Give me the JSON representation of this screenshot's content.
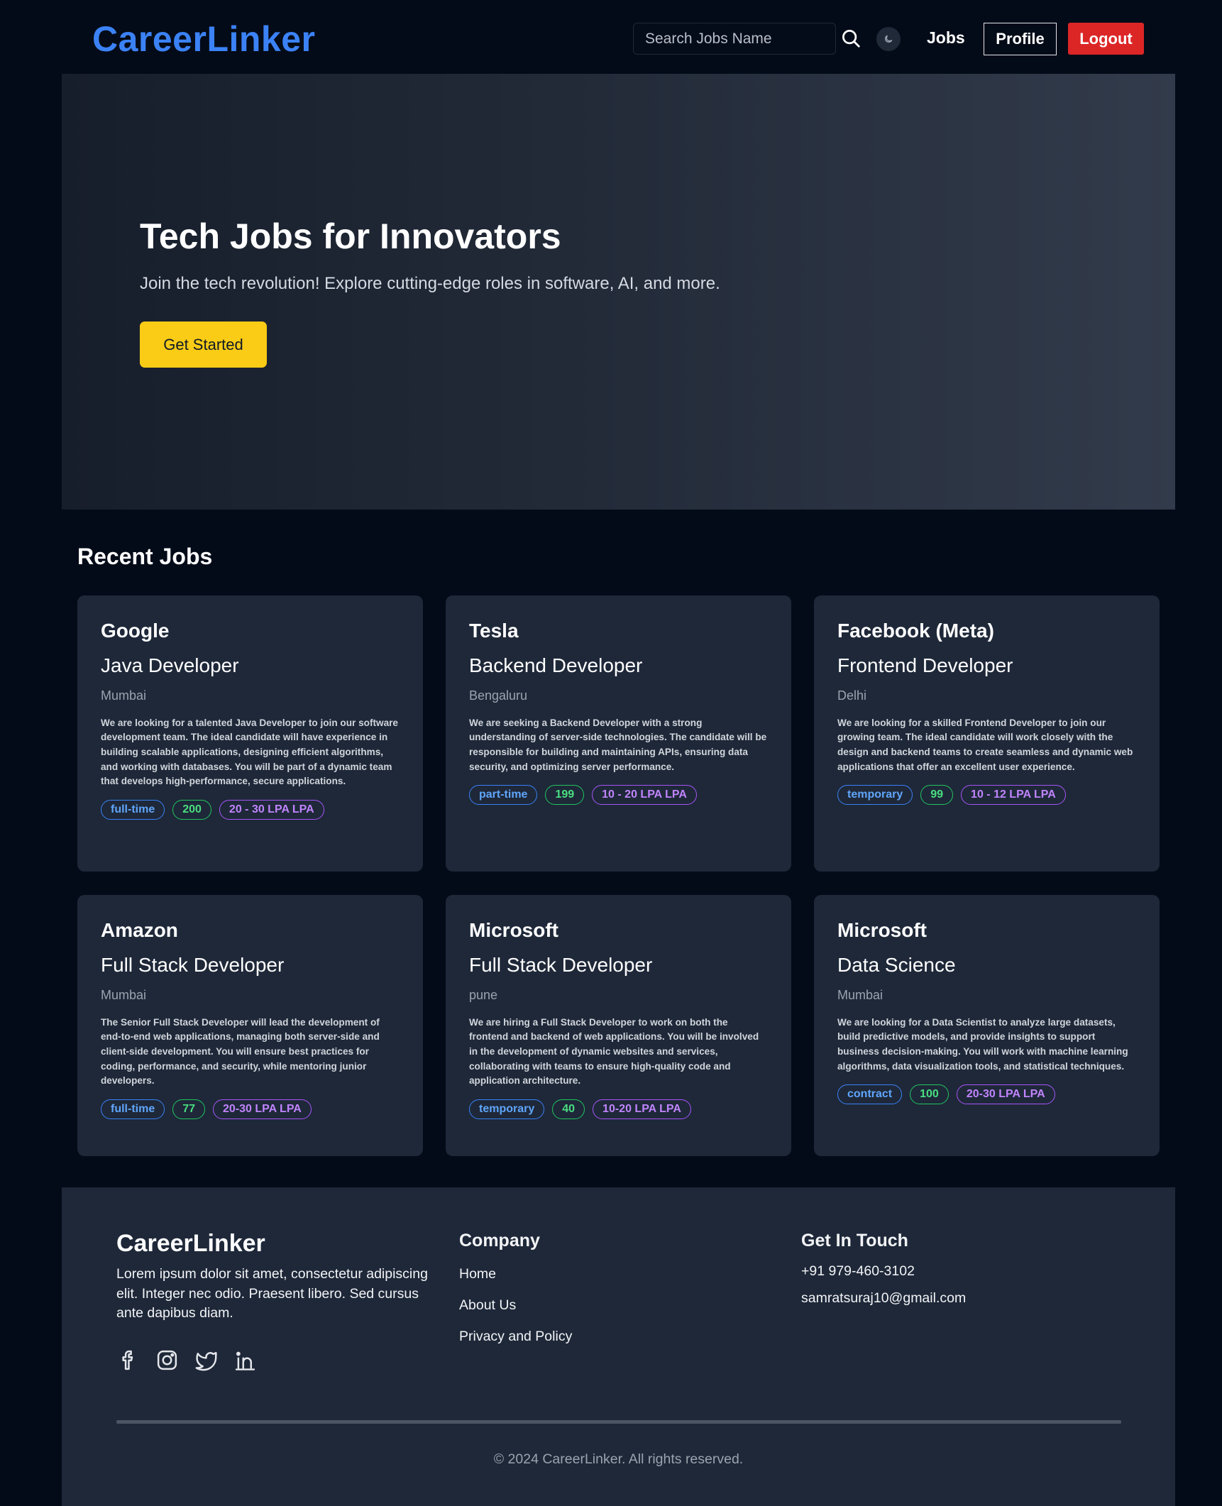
{
  "nav": {
    "brand": "CareerLinker",
    "search_placeholder": "Search Jobs Name",
    "jobs_label": "Jobs",
    "profile_label": "Profile",
    "logout_label": "Logout"
  },
  "hero": {
    "title": "Tech Jobs for Innovators",
    "subtitle": "Join the tech revolution! Explore cutting-edge roles in software, AI, and more.",
    "cta_label": "Get Started"
  },
  "recent_jobs": {
    "title": "Recent Jobs",
    "jobs": [
      {
        "company": "Google",
        "role": "Java Developer",
        "location": "Mumbai",
        "description": "We are looking for a talented Java Developer to join our software development team. The ideal candidate will have experience in building scalable applications, designing efficient algorithms, and working with databases. You will be part of a dynamic team that develops high-performance, secure applications.",
        "type": "full-time",
        "positions": "200",
        "salary": "20 - 30 LPA LPA"
      },
      {
        "company": "Tesla",
        "role": "Backend Developer",
        "location": "Bengaluru",
        "description": "We are seeking a Backend Developer with a strong understanding of server-side technologies. The candidate will be responsible for building and maintaining APIs, ensuring data security, and optimizing server performance.",
        "type": "part-time",
        "positions": "199",
        "salary": "10 - 20 LPA LPA"
      },
      {
        "company": "Facebook (Meta)",
        "role": "Frontend Developer",
        "location": "Delhi",
        "description": "We are looking for a skilled Frontend Developer to join our growing team. The ideal candidate will work closely with the design and backend teams to create seamless and dynamic web applications that offer an excellent user experience.",
        "type": "temporary",
        "positions": "99",
        "salary": "10 - 12 LPA LPA"
      },
      {
        "company": "Amazon",
        "role": "Full Stack Developer",
        "location": "Mumbai",
        "description": "The Senior Full Stack Developer will lead the development of end-to-end web applications, managing both server-side and client-side development. You will ensure best practices for coding, performance, and security, while mentoring junior developers.",
        "type": "full-time",
        "positions": "77",
        "salary": "20-30 LPA LPA"
      },
      {
        "company": "Microsoft",
        "role": "Full Stack Developer",
        "location": "pune",
        "description": "We are hiring a Full Stack Developer to work on both the frontend and backend of web applications. You will be involved in the development of dynamic websites and services, collaborating with teams to ensure high-quality code and application architecture.",
        "type": "temporary",
        "positions": "40",
        "salary": "10-20 LPA LPA"
      },
      {
        "company": "Microsoft",
        "role": "Data Science",
        "location": "Mumbai",
        "description": "We are looking for a Data Scientist to analyze large datasets, build predictive models, and provide insights to support business decision-making. You will work with machine learning algorithms, data visualization tools, and statistical techniques.",
        "type": "contract",
        "positions": "100",
        "salary": "20-30 LPA LPA"
      }
    ]
  },
  "footer": {
    "brand": "CareerLinker",
    "about": "Lorem ipsum dolor sit amet, consectetur adipiscing elit. Integer nec odio. Praesent libero. Sed cursus ante dapibus diam.",
    "socials": [
      "facebook-icon",
      "instagram-icon",
      "twitter-icon",
      "linkedin-icon"
    ],
    "company_heading": "Company",
    "company_links": [
      "Home",
      "About Us",
      "Privacy and Policy"
    ],
    "contact_heading": "Get In Touch",
    "phone": "+91 979-460-3102",
    "email": "samratsuraj10@gmail.com",
    "copyright": "© 2024 CareerLinker. All rights reserved."
  },
  "colors": {
    "background": "#040b18",
    "brand_blue": "#3b82f6",
    "card_bg": "#1e2839",
    "cta_yellow": "#facc15",
    "logout_red": "#dc2626",
    "tag_type": "#3b82f6",
    "tag_count": "#22c55e",
    "tag_salary": "#a855f7"
  }
}
